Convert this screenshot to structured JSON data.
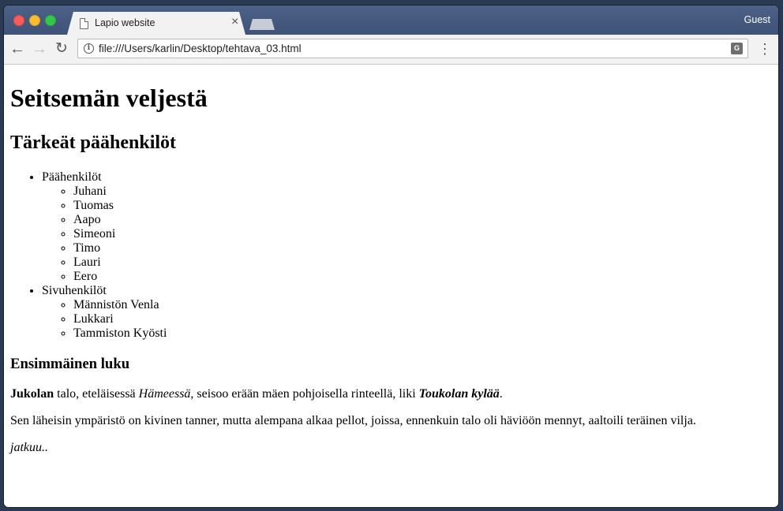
{
  "browser": {
    "tab_title": "Lapio website",
    "tab_close": "×",
    "profile": "Guest",
    "url": "file:///Users/karlin/Desktop/tehtava_03.html",
    "icons": {
      "back": "back-arrow-icon",
      "forward": "forward-arrow-icon",
      "reload": "reload-icon",
      "info": "info-icon",
      "translate": "translate-icon",
      "menu": "kebab-menu-icon"
    }
  },
  "page": {
    "h1": "Seitsemän veljestä",
    "h2": "Tärkeät päähenkilöt",
    "groups": [
      {
        "label": "Päähenkilöt",
        "items": [
          "Juhani",
          "Tuomas",
          "Aapo",
          "Simeoni",
          "Timo",
          "Lauri",
          "Eero"
        ]
      },
      {
        "label": "Sivuhenkilöt",
        "items": [
          "Männistön Venla",
          "Lukkari",
          "Tammiston Kyösti"
        ]
      }
    ],
    "h3": "Ensimmäinen luku",
    "p1": {
      "bold": "Jukolan",
      "text1": " talo, eteläisessä ",
      "italic": "Hämeessä",
      "text2": ", seisoo erään mäen pohjoisella rinteellä, liki ",
      "bold_italic": "Toukolan kylää",
      "text3": "."
    },
    "p2": "Sen läheisin ympäristö on kivinen tanner, mutta alempana alkaa pellot, joissa, ennenkuin talo oli häviöön mennyt, aaltoili teräinen vilja.",
    "p3": "jatkuu.."
  }
}
